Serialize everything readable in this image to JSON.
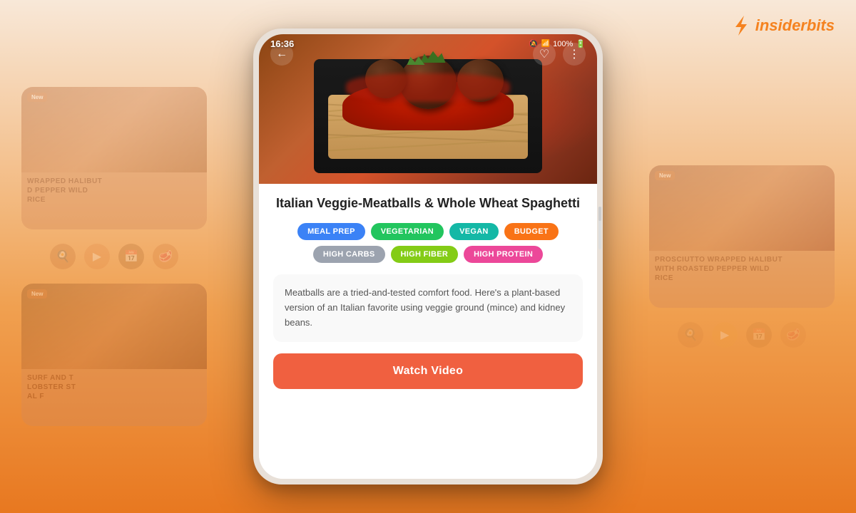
{
  "background": {
    "gradient_start": "#f8e8d8",
    "gradient_end": "#e87820"
  },
  "logo": {
    "text_black": "insider",
    "text_orange": "bits",
    "full_text": "insiderbits"
  },
  "status_bar": {
    "time": "16:36",
    "battery": "100%"
  },
  "recipe": {
    "title": "Italian Veggie-Meatballs & Whole Wheat Spaghetti",
    "tags": [
      {
        "label": "MEAL PREP",
        "style": "blue"
      },
      {
        "label": "VEGETARIAN",
        "style": "green"
      },
      {
        "label": "VEGAN",
        "style": "teal"
      },
      {
        "label": "BUDGET",
        "style": "orange"
      },
      {
        "label": "HIGH CARBS",
        "style": "gray"
      },
      {
        "label": "HIGH FIBER",
        "style": "olive"
      },
      {
        "label": "HIGH PROTEIN",
        "style": "pink"
      }
    ],
    "description": "Meatballs are a tried-and-tested comfort food. Here's a plant-based version of an Italian favorite using veggie ground (mince) and kidney beans.",
    "watch_video_label": "Watch Video"
  },
  "nav": {
    "back_icon": "←",
    "heart_icon": "♡",
    "more_icon": "⋮"
  },
  "bg_cards": [
    {
      "label": "PROSCIUTTO WRAPPED HALIBUT WITH ROASTED PEPPER WILD RICE",
      "tag": "New"
    },
    {
      "label": "SURF AND THE LOBSTER STEAK AL F...",
      "tag": "New"
    },
    {
      "label": "WRAPPED HALIBUT D PEPPER WILD RICE",
      "tag": "New"
    }
  ]
}
